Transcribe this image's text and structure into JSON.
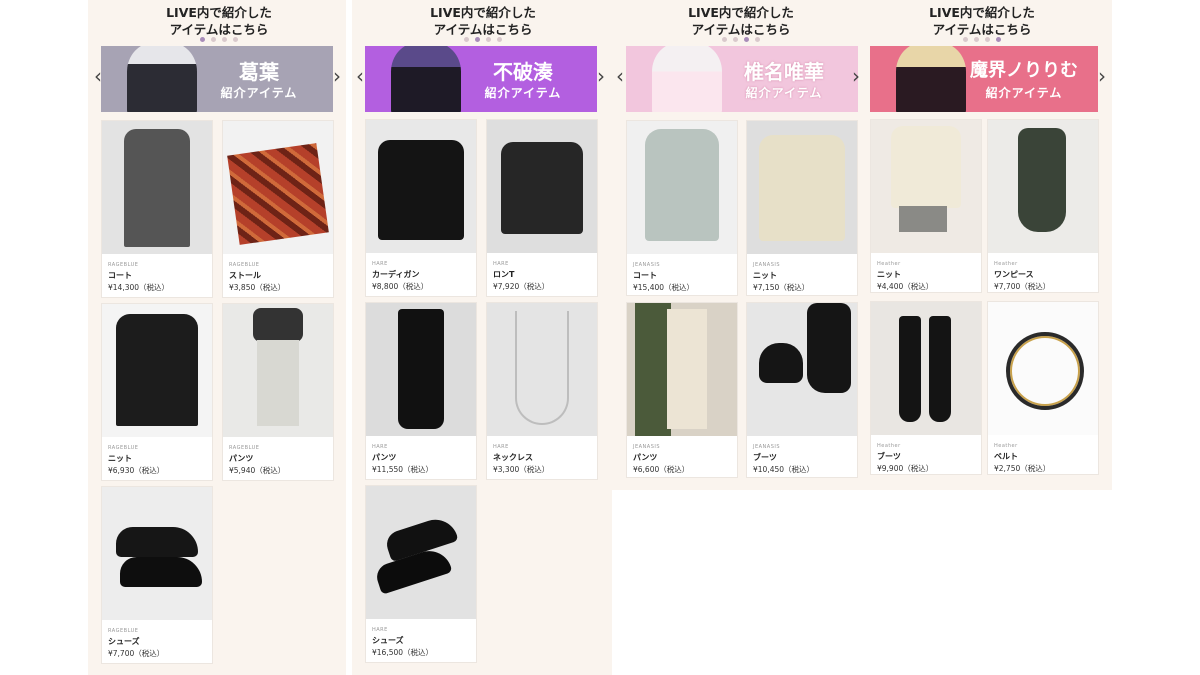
{
  "columns": [
    {
      "title_line1": "LIVE内で紹介した",
      "title_line2": "アイテムはこちら",
      "banner_name": "葛葉",
      "banner_sub": "紹介アイテム",
      "banner_color": "#a7a3b4",
      "name_color": "#ffffff",
      "items": [
        {
          "brand": "RAGEBLUE",
          "name": "コート",
          "price": "¥14,300（税込）"
        },
        {
          "brand": "RAGEBLUE",
          "name": "ストール",
          "price": "¥3,850（税込）"
        },
        {
          "brand": "RAGEBLUE",
          "name": "ニット",
          "price": "¥6,930（税込）"
        },
        {
          "brand": "RAGEBLUE",
          "name": "パンツ",
          "price": "¥5,940（税込）"
        },
        {
          "brand": "RAGEBLUE",
          "name": "シューズ",
          "price": "¥7,700（税込）"
        }
      ]
    },
    {
      "title_line1": "LIVE内で紹介した",
      "title_line2": "アイテムはこちら",
      "banner_name": "不破湊",
      "banner_sub": "紹介アイテム",
      "banner_color": "#b35fe0",
      "name_color": "#ffffff",
      "items": [
        {
          "brand": "HARE",
          "name": "カーディガン",
          "price": "¥8,800（税込）"
        },
        {
          "brand": "HARE",
          "name": "ロンT",
          "price": "¥7,920（税込）"
        },
        {
          "brand": "HARE",
          "name": "パンツ",
          "price": "¥11,550（税込）"
        },
        {
          "brand": "HARE",
          "name": "ネックレス",
          "price": "¥3,300（税込）"
        },
        {
          "brand": "HARE",
          "name": "シューズ",
          "price": "¥16,500（税込）"
        }
      ]
    },
    {
      "title_line1": "LIVE内で紹介した",
      "title_line2": "アイテムはこちら",
      "banner_name": "椎名唯華",
      "banner_sub": "紹介アイテム",
      "banner_color": "#f2c6dd",
      "name_color": "#ffffff",
      "items": [
        {
          "brand": "JEANASIS",
          "name": "コート",
          "price": "¥15,400（税込）"
        },
        {
          "brand": "JEANASIS",
          "name": "ニット",
          "price": "¥7,150（税込）"
        },
        {
          "brand": "JEANASIS",
          "name": "パンツ",
          "price": "¥6,600（税込）"
        },
        {
          "brand": "JEANASIS",
          "name": "ブーツ",
          "price": "¥10,450（税込）"
        }
      ]
    },
    {
      "title_line1": "LIVE内で紹介した",
      "title_line2": "アイテムはこちら",
      "banner_name": "魔界ノりりむ",
      "banner_sub": "紹介アイテム",
      "banner_color": "#e8708a",
      "name_color": "#ffffff",
      "items": [
        {
          "brand": "Heather",
          "name": "ニット",
          "price": "¥4,400（税込）"
        },
        {
          "brand": "Heather",
          "name": "ワンピース",
          "price": "¥7,700（税込）"
        },
        {
          "brand": "Heather",
          "name": "ブーツ",
          "price": "¥9,900（税込）"
        },
        {
          "brand": "Heather",
          "name": "ベルト",
          "price": "¥2,750（税込）"
        }
      ]
    }
  ]
}
